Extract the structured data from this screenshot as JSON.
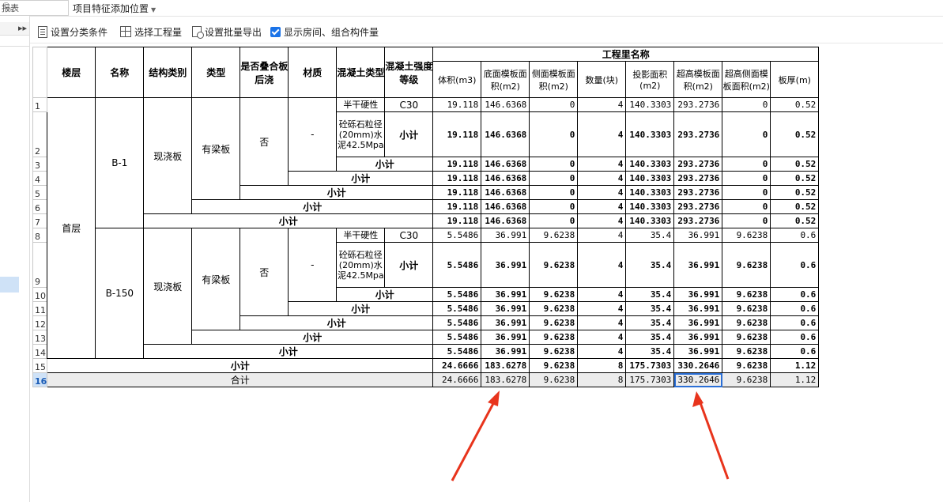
{
  "topbar": {
    "left_input_text": "报表",
    "location_label": "项目特征添加位置"
  },
  "left_panel": {
    "collapse_glyph": "▸▸"
  },
  "toolbar": {
    "set_category": "设置分类条件",
    "select_quantity": "选择工程量",
    "batch_export": "设置批量导出",
    "show_rooms": "显示房间、组合构件量"
  },
  "table": {
    "headers": {
      "floor": "楼层",
      "name": "名称",
      "struct_type": "结构类别",
      "category": "类型",
      "laminated": "是否叠合板后浇",
      "material": "材质",
      "concrete_type": "混凝土类型",
      "concrete_grade": "混凝土强度等级",
      "group": "工程里名称",
      "volume": "体积(m3)",
      "bottom_form": "底面模板面积(m2)",
      "side_form": "侧面模板面积(m2)",
      "count": "数量(块)",
      "proj_area": "投影面积(m2)",
      "super_form": "超高模板面积(m2)",
      "super_side": "超高侧面模板面积(m2)",
      "thickness": "板厚(m)"
    },
    "labels": {
      "floor": "首层",
      "name_a": "B-1",
      "name_b": "B-150",
      "struct": "现浇板",
      "cat": "有梁板",
      "laminated": "否",
      "material": "-",
      "concrete": "半干硬性砼砾石粒径(20mm)水泥42.5Mpa",
      "concrete_split1": "半干硬性",
      "concrete_split2": "砼砾石粒径(20mm)水泥42.5Mpa",
      "grade": "C30",
      "subtotal": "小计",
      "total": "合计"
    },
    "row_numbers": [
      "1",
      "2",
      "3",
      "4",
      "5",
      "6",
      "7",
      "8",
      "9",
      "10",
      "11",
      "12",
      "13",
      "14",
      "15",
      "16"
    ],
    "b1": {
      "v": "19.118",
      "b": "146.6368",
      "s": "0",
      "c": "4",
      "p": "140.3303",
      "h": "293.2736",
      "hs": "0",
      "t": "0.52"
    },
    "b150": {
      "v": "5.5486",
      "b": "36.991",
      "s": "9.6238",
      "c": "4",
      "p": "35.4",
      "h": "36.991",
      "hs": "9.6238",
      "t": "0.6"
    },
    "floor_sub": {
      "v": "24.6666",
      "b": "183.6278",
      "s": "9.6238",
      "c": "8",
      "p": "175.7303",
      "h": "330.2646",
      "hs": "9.6238",
      "t": "1.12"
    },
    "total": {
      "v": "24.6666",
      "b": "183.6278",
      "s": "9.6238",
      "c": "8",
      "p": "175.7303",
      "h": "330.2646",
      "hs": "9.6238",
      "t": "1.12"
    }
  },
  "annotation": {
    "arrow_color": "#e8341c"
  }
}
